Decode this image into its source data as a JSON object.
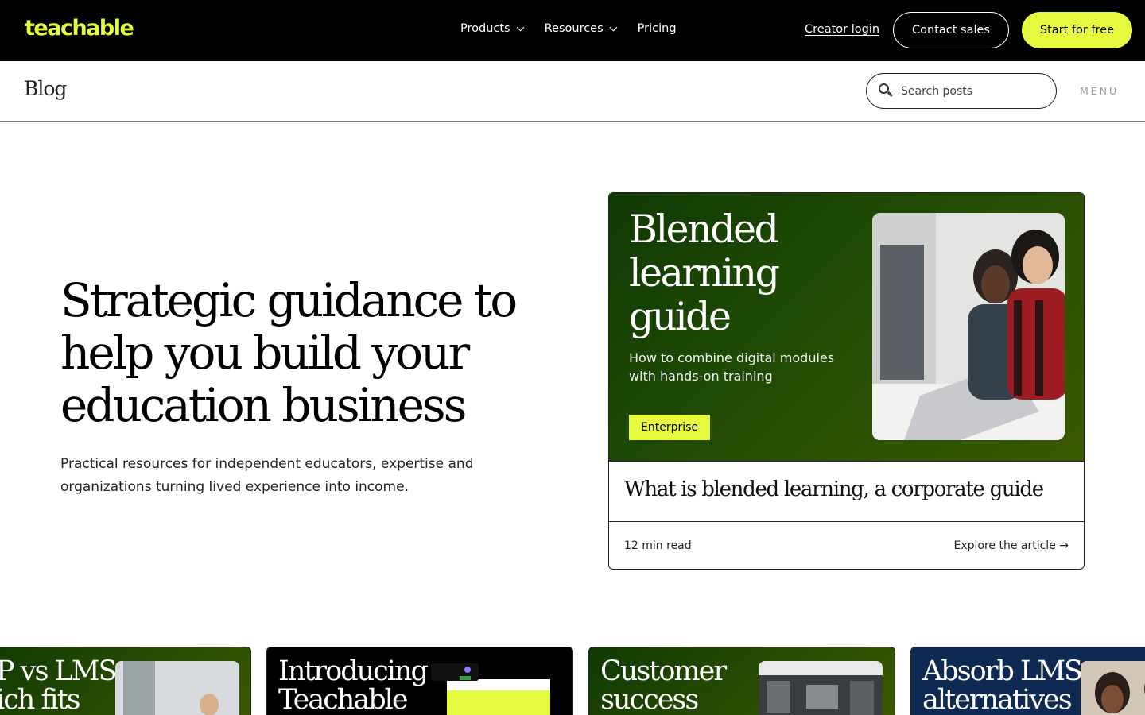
{
  "topnav": {
    "logo": "teachable",
    "links": [
      {
        "label": "Products",
        "has_dropdown": true
      },
      {
        "label": "Resources",
        "has_dropdown": true
      },
      {
        "label": "Pricing",
        "has_dropdown": false
      }
    ],
    "creator_login": "Creator login",
    "contact_sales": "Contact sales",
    "start_free": "Start for free"
  },
  "blogbar": {
    "title": "Blog",
    "search_placeholder": "Search posts",
    "menu_label": "MENU"
  },
  "hero": {
    "title": "Strategic guidance to help you build your education business",
    "subtitle": "Practical resources for independent educators, expertise and organizations turning lived experience into income."
  },
  "featured": {
    "heading": "Blended learning guide",
    "description": "How to combine digital modules with hands-on training",
    "tag": "Enterprise",
    "title": "What is blended learning, a corporate guide",
    "read_time": "12 min read",
    "explore": "Explore the article →"
  },
  "strip_cards": [
    {
      "title": "P vs LMS:\nich fits"
    },
    {
      "title": "Introducing\nTeachable"
    },
    {
      "title": "Customer\nsuccess"
    },
    {
      "title": "Absorb LMS\nalternatives"
    }
  ],
  "colors": {
    "accent": "#e6fb3f",
    "nav_bg": "#000000",
    "feature_bg": "#1f4a05",
    "navy_card": "#0e2a52"
  }
}
